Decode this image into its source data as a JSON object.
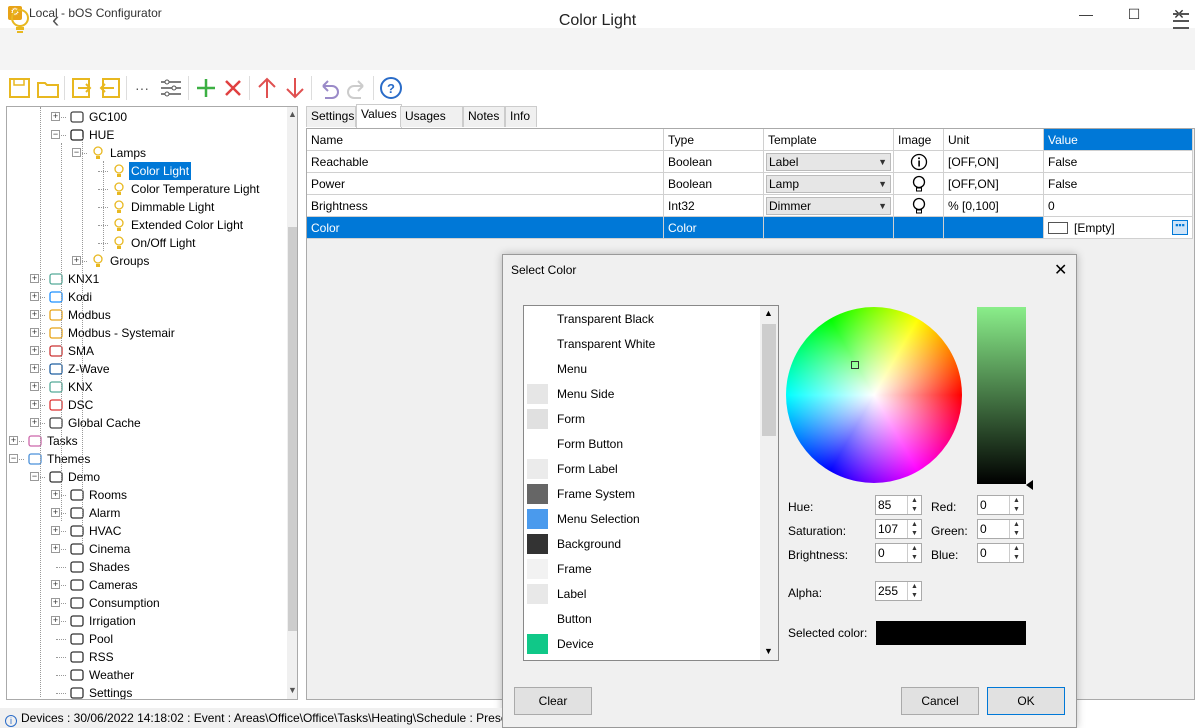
{
  "window": {
    "title": "Local - bOS Configurator",
    "minimize": "—",
    "maximize": "☐",
    "close": "✕"
  },
  "header": {
    "title": "Color Light",
    "back": "‹"
  },
  "toolbar": {
    "more_label": "···"
  },
  "tree": [
    {
      "label": "GC100",
      "icon": "device-icon"
    },
    {
      "label": "HUE",
      "icon": "hue-icon"
    },
    {
      "label": "Lamps",
      "icon": "lamps-icon"
    },
    {
      "label": "Color Light",
      "icon": "bulb-icon",
      "selected": true
    },
    {
      "label": "Color Temperature Light",
      "icon": "bulb-icon"
    },
    {
      "label": "Dimmable Light",
      "icon": "bulb-icon"
    },
    {
      "label": "Extended Color Light",
      "icon": "bulb-icon"
    },
    {
      "label": "On/Off Light",
      "icon": "bulb-icon"
    },
    {
      "label": "Groups",
      "icon": "groups-icon"
    },
    {
      "label": "KNX1",
      "icon": "knx-icon"
    },
    {
      "label": "Kodi",
      "icon": "kodi-icon"
    },
    {
      "label": "Modbus",
      "icon": "gear-icon"
    },
    {
      "label": "Modbus - Systemair",
      "icon": "gear-icon"
    },
    {
      "label": "SMA",
      "icon": "sma-icon"
    },
    {
      "label": "Z-Wave",
      "icon": "zwave-icon"
    },
    {
      "label": "KNX",
      "icon": "knx-icon"
    },
    {
      "label": "DSC",
      "icon": "dsc-icon"
    },
    {
      "label": "Global Cache",
      "icon": "device-icon"
    },
    {
      "label": "Tasks",
      "icon": "tasks-icon"
    },
    {
      "label": "Themes",
      "icon": "themes-icon"
    },
    {
      "label": "Demo",
      "icon": "building-icon"
    },
    {
      "label": "Rooms",
      "icon": "rooms-icon"
    },
    {
      "label": "Alarm",
      "icon": "bell-icon"
    },
    {
      "label": "HVAC",
      "icon": "flame-icon"
    },
    {
      "label": "Cinema",
      "icon": "cinema-icon"
    },
    {
      "label": "Shades",
      "icon": "shades-icon"
    },
    {
      "label": "Cameras",
      "icon": "camera-icon"
    },
    {
      "label": "Consumption",
      "icon": "meter-icon"
    },
    {
      "label": "Irrigation",
      "icon": "irrigation-icon"
    },
    {
      "label": "Pool",
      "icon": "pool-icon"
    },
    {
      "label": "RSS",
      "icon": "rss-icon"
    },
    {
      "label": "Weather",
      "icon": "weather-icon"
    },
    {
      "label": "Settings",
      "icon": "wrench-icon"
    }
  ],
  "tabs": [
    "Settings",
    "Values",
    "Usages (0)",
    "Notes",
    "Info"
  ],
  "grid": {
    "headers": [
      "Name",
      "Type",
      "Template",
      "Image",
      "Unit",
      "Value"
    ],
    "rows": [
      {
        "name": "Reachable",
        "type": "Boolean",
        "template": "Label",
        "image": "info-icon",
        "unit": "[OFF,ON]",
        "value": "False"
      },
      {
        "name": "Power",
        "type": "Boolean",
        "template": "Lamp",
        "image": "bulb-icon",
        "unit": "[OFF,ON]",
        "value": "False"
      },
      {
        "name": "Brightness",
        "type": "Int32",
        "template": "Dimmer",
        "image": "bulb-icon",
        "unit": "% [0,100]",
        "value": "0"
      },
      {
        "name": "Color",
        "type": "Color",
        "template": "",
        "image": "",
        "unit": "",
        "value": "[Empty]"
      }
    ]
  },
  "dialog": {
    "title": "Select Color",
    "colors": [
      {
        "name": "Transparent Black",
        "color": ""
      },
      {
        "name": "Transparent White",
        "color": ""
      },
      {
        "name": "Menu",
        "color": ""
      },
      {
        "name": "Menu Side",
        "color": "#e6e6e6"
      },
      {
        "name": "Form",
        "color": "#e0e0e0"
      },
      {
        "name": "Form Button",
        "color": ""
      },
      {
        "name": "Form Label",
        "color": "#ebebeb"
      },
      {
        "name": "Frame System",
        "color": "#666666"
      },
      {
        "name": "Menu Selection",
        "color": "#4a9aed"
      },
      {
        "name": "Background",
        "color": "#333333"
      },
      {
        "name": "Frame",
        "color": "#f2f2f2"
      },
      {
        "name": "Label",
        "color": "#e8e8e8"
      },
      {
        "name": "Button",
        "color": ""
      },
      {
        "name": "Device",
        "color": "#10c888"
      }
    ],
    "fields": {
      "hue_label": "Hue:",
      "hue": "85",
      "saturation_label": "Saturation:",
      "saturation": "107",
      "brightness_label": "Brightness:",
      "brightness": "0",
      "red_label": "Red:",
      "red": "0",
      "green_label": "Green:",
      "green": "0",
      "blue_label": "Blue:",
      "blue": "0",
      "alpha_label": "Alpha:",
      "alpha": "255",
      "selected_label": "Selected color:",
      "selected_color": "#000000"
    },
    "buttons": {
      "clear": "Clear",
      "cancel": "Cancel",
      "ok": "OK"
    }
  },
  "status": {
    "text": "Devices : 30/06/2022 14:18:02 : Event : Areas\\Office\\Office\\Tasks\\Heating\\Schedule : Presen"
  }
}
